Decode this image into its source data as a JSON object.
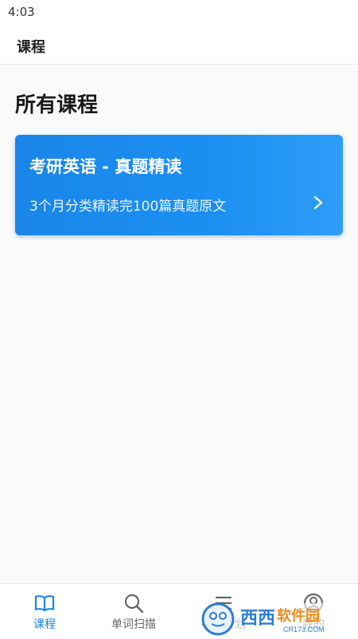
{
  "status_bar": {
    "time": "4:03"
  },
  "app_bar": {
    "title": "课程"
  },
  "main": {
    "heading": "所有课程",
    "courses": [
      {
        "title": "考研英语 - 真题精读",
        "subtitle": "3个月分类精读完100篇真题原文",
        "chevron_icon": "chevron-right-icon"
      }
    ]
  },
  "bottom_nav": {
    "items": [
      {
        "label": "课程",
        "icon": "book-icon",
        "active": true
      },
      {
        "label": "单词扫描",
        "icon": "search-icon",
        "active": false
      },
      {
        "label": "学习计划",
        "icon": "list-icon",
        "active": false
      },
      {
        "label": "我的",
        "icon": "user-icon",
        "active": false
      }
    ]
  },
  "watermark": {
    "brand": "西西软件园",
    "domain": "CR173.COM"
  },
  "colors": {
    "accent": "#1a86e9",
    "card_gradient_start": "#1a86e9",
    "card_gradient_end": "#2d9df6",
    "nav_inactive": "#666666"
  }
}
